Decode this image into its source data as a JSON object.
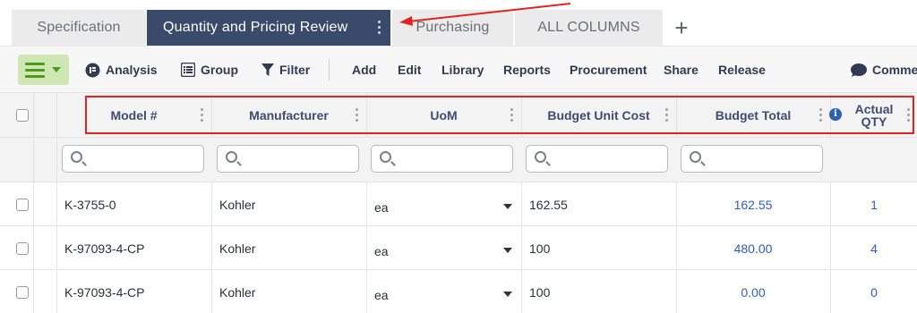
{
  "tabs": [
    {
      "label": "Specification",
      "active": false
    },
    {
      "label": "Quantity and Pricing Review",
      "active": true
    },
    {
      "label": "Purchasing",
      "active": false
    },
    {
      "label": "ALL COLUMNS",
      "active": false
    }
  ],
  "add_tab_label": "+",
  "toolbar": {
    "analysis": "Analysis",
    "group": "Group",
    "filter": "Filter",
    "add": "Add",
    "edit": "Edit",
    "library": "Library",
    "reports": "Reports",
    "procurement": "Procurement",
    "share": "Share",
    "release": "Release",
    "comments": "Comme"
  },
  "columns": {
    "model": "Model #",
    "manufacturer": "Manufacturer",
    "uom": "UoM",
    "budget_unit_cost": "Budget Unit Cost",
    "budget_total": "Budget Total",
    "actual_qty_line1": "Actual",
    "actual_qty_line2": "QTY"
  },
  "rows": [
    {
      "model": "K-3755-0",
      "manufacturer": "Kohler",
      "uom": "ea",
      "budget_unit_cost": "162.55",
      "budget_total": "162.55",
      "actual_qty": "1"
    },
    {
      "model": "K-97093-4-CP",
      "manufacturer": "Kohler",
      "uom": "ea",
      "budget_unit_cost": "100",
      "budget_total": "480.00",
      "actual_qty": "4"
    },
    {
      "model": "K-97093-4-CP",
      "manufacturer": "Kohler",
      "uom": "ea",
      "budget_unit_cost": "100",
      "budget_total": "0.00",
      "actual_qty": "0"
    }
  ],
  "colors": {
    "active_tab": "#3a4a6b",
    "header_text": "#3c4d71",
    "link_value": "#2f5fb3",
    "menu_button": "#cfe8b3",
    "annotation": "#e02424"
  }
}
